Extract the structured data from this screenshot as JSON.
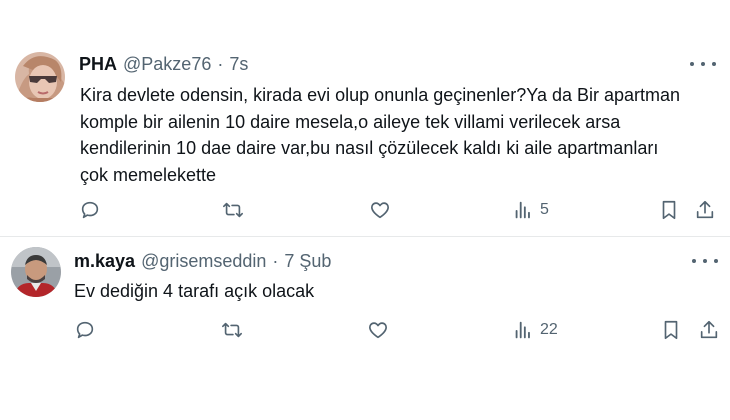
{
  "tweets": [
    {
      "display_name": "PHA",
      "handle": "@Pakze76",
      "separator": "·",
      "time": "7s",
      "text_lines": [
        "Kira devlete odensin, kirada evi olup onunla geçinenler?Ya da Bir apartman",
        "komple bir ailenin 10 daire mesela,o aileye tek villami verilecek arsa",
        "kendilerinin 10 dae daire var,bu nasıl çözülecek kaldı ki aile apartmanları",
        "çok memelekette"
      ],
      "views": "5",
      "avatar_icon": "avatar-woman-sunglasses"
    },
    {
      "display_name": "m.kaya",
      "handle": "@grisemseddin",
      "separator": "·",
      "time": "7 Şub",
      "text_lines": [
        "Ev dediğin 4 tarafı açık olacak"
      ],
      "views": "22",
      "avatar_icon": "avatar-man"
    }
  ],
  "colors": {
    "text": "#0f1419",
    "secondary": "#536471",
    "divider": "#e7e9ea"
  }
}
